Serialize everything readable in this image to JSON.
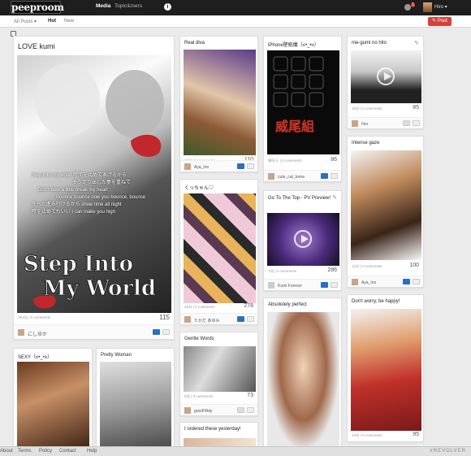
{
  "topbar": {
    "logo": "peeproom",
    "nav": [
      "Media",
      "Topics",
      "Users"
    ],
    "notifications": "1",
    "user": "Hiro"
  },
  "subbar": {
    "filters": [
      "All Posts",
      "Hot",
      "New"
    ],
    "post_label": "Post"
  },
  "cards": {
    "c1": {
      "title": "LOVE kumi",
      "meta": "253分 | 0 comments",
      "count": "115",
      "user": "にしゆか",
      "image_text": {
        "line1": "Step Into",
        "line2": "My World",
        "lyrics": [
          "Step into my world 時間を止めてあげるから",
          "そう走り出した夢を重ねて",
          "Don't take a little break my heart",
          "Bounce bounce now you bounce, bounce",
          "先へと進み行けるから show time all night",
          "時を止めてもいい I can make you high"
        ]
      }
    },
    "c2": {
      "title": "Real diva",
      "meta": "15分 | 0 comments",
      "count": "110",
      "user": "Aya_Ino"
    },
    "c3": {
      "title": "くっちゃん♡",
      "meta": "45分 | 0 comments",
      "count": "278",
      "user": "たかだ あゆみ"
    },
    "c4": {
      "title": "Gentle Words",
      "meta": "5分 | 0 comments",
      "count": "73",
      "user": "good!Wdy"
    },
    "c5": {
      "title": "I ordered these yesterday!"
    },
    "c6": {
      "title": "iPhone壁紙儀（≤•_•≥）",
      "meta": "納分入 | 0 comments",
      "count": "86",
      "user": "cute_cat_toma",
      "image_text": "威尾組"
    },
    "c7": {
      "title": "Go To The Top - PV Preview!",
      "meta": "7分 | 0 comments",
      "count": "286",
      "user": "Kumi Forever"
    },
    "c8": {
      "title": "Absolutely perfect"
    },
    "c9": {
      "title": "me-gumi no hito",
      "meta": "15分 | 0 comments",
      "count": "85",
      "user": "hiro"
    },
    "c10": {
      "title": "Intense gaze",
      "meta": "12分 | 0 comments",
      "count": "100",
      "user": "Aya_Ino"
    },
    "c11": {
      "title": "Don't worry, be happy!",
      "meta": "10分 | 0 comments",
      "count": "95"
    },
    "c12": {
      "title": "SEXY（≤•_•≥）"
    },
    "c13": {
      "title": "Pretty Woman"
    }
  },
  "bottombar": {
    "links": [
      "About",
      "Terms",
      "Policy",
      "Contact",
      "Help"
    ],
    "brand": "#REVOLVER"
  },
  "colors": {
    "topbar": "#1e1e1e",
    "accent": "#d5413a",
    "like": "#2b6fc3"
  }
}
